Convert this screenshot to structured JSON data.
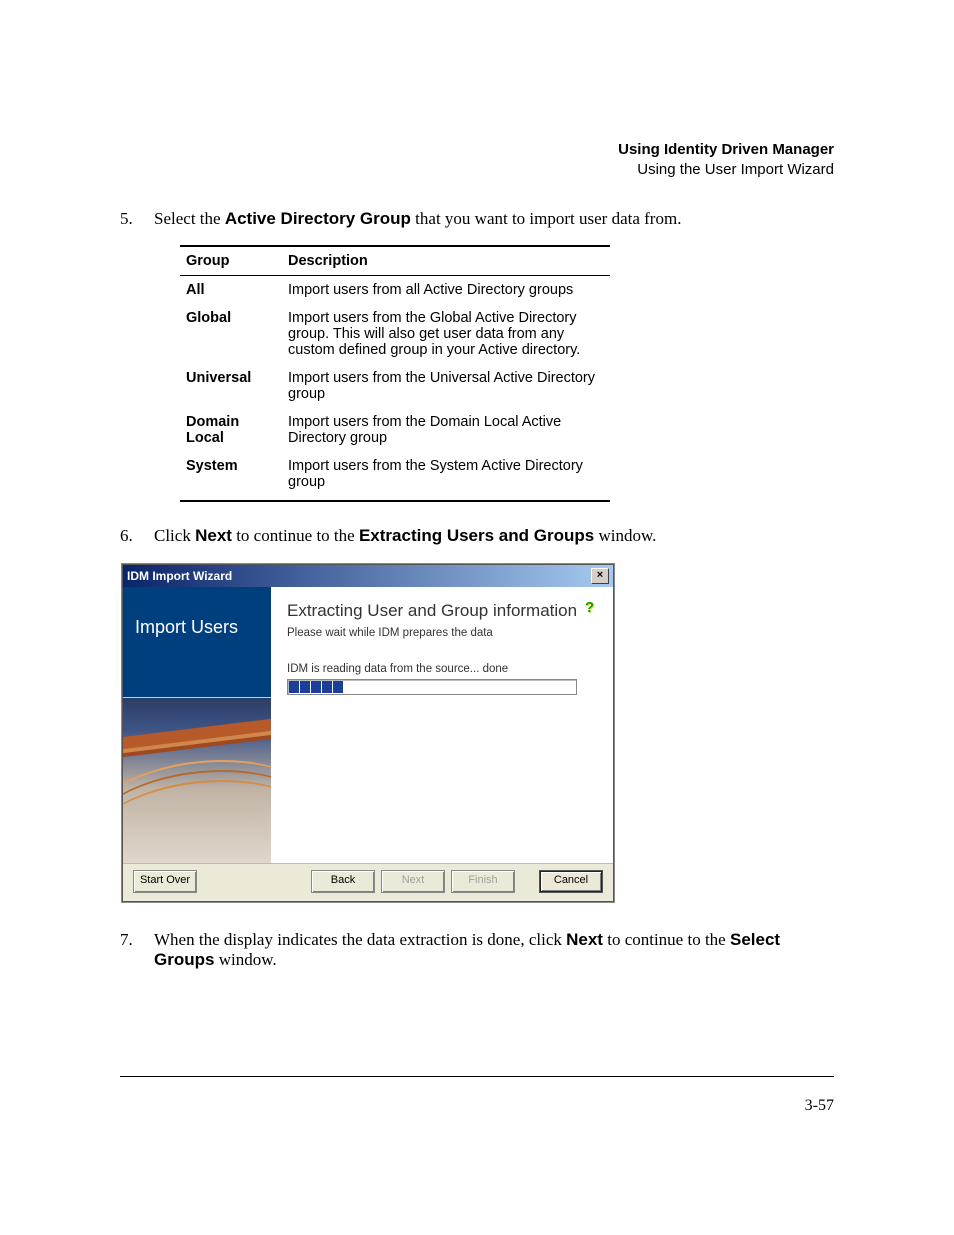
{
  "header": {
    "title": "Using Identity Driven Manager",
    "subtitle": "Using the User Import Wizard"
  },
  "step5": {
    "num": "5.",
    "pre": "Select the ",
    "linklabel": "Active Directory Group",
    "post": " that you want to import user data from."
  },
  "table": {
    "headers": {
      "group": "Group",
      "desc": "Description"
    },
    "rows": [
      {
        "group": "All",
        "desc": "Import users from all Active Directory groups"
      },
      {
        "group": "Global",
        "desc": "Import users from the Global Active Directory group. This will also get user data from any custom defined group in your Active directory."
      },
      {
        "group": "Universal",
        "desc": "Import users from the Universal Active Directory group"
      },
      {
        "group": "Domain Local",
        "desc": "Import users from the Domain Local Active Directory group"
      },
      {
        "group": "System",
        "desc": "Import users from the System Active Directory group"
      }
    ]
  },
  "step6": {
    "num": "6.",
    "pre": "Click ",
    "bold": "Next",
    "mid": " to continue to the ",
    "link": "Extracting Users and Groups",
    "post": " window."
  },
  "dialog": {
    "title": "IDM Import Wizard",
    "close": "×",
    "sidebar": "Import Users",
    "main_title": "Extracting User and Group information",
    "main_sub": "Please wait while IDM prepares the data",
    "status": "IDM is reading data from the source... done",
    "buttons": {
      "start_over": "Start Over",
      "back": "Back",
      "next": "Next",
      "finish": "Finish",
      "cancel": "Cancel"
    }
  },
  "step7": {
    "num": "7.",
    "pre": "When the display indicates the data extraction is done, click ",
    "bold": "Next",
    "mid": " to continue to the ",
    "link": "Select Groups",
    "post": " window."
  },
  "footer": {
    "pagenum": "3-57"
  }
}
